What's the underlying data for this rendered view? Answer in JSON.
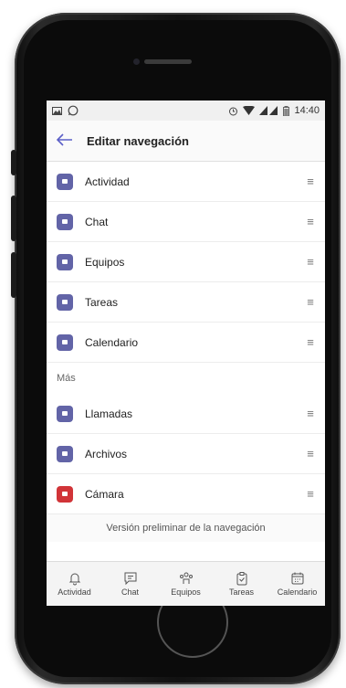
{
  "statusbar": {
    "left_icons": [
      "image-icon",
      "whatsapp-icon"
    ],
    "right_icons": [
      "alarm-icon",
      "wifi-icon",
      "signal-icon",
      "battery-icon"
    ],
    "time": "14:40"
  },
  "appbar": {
    "title": "Editar navegación",
    "back_icon": "arrow-back-icon"
  },
  "nav_items": [
    {
      "label": "Actividad",
      "icon": "activity-icon",
      "color": "#6264a7"
    },
    {
      "label": "Chat",
      "icon": "chat-icon",
      "color": "#6264a7"
    },
    {
      "label": "Equipos",
      "icon": "teams-icon",
      "color": "#6264a7"
    },
    {
      "label": "Tareas",
      "icon": "tasks-icon",
      "color": "#6264a7"
    },
    {
      "label": "Calendario",
      "icon": "calendar-icon",
      "color": "#6264a7"
    }
  ],
  "more_section": {
    "label": "Más"
  },
  "more_items": [
    {
      "label": "Llamadas",
      "icon": "calls-icon",
      "color": "#6264a7"
    },
    {
      "label": "Archivos",
      "icon": "files-icon",
      "color": "#6264a7"
    },
    {
      "label": "Cámara",
      "icon": "camera-icon",
      "color": "#d13438"
    }
  ],
  "preview": {
    "label": "Versión preliminar de la navegación"
  },
  "bottom_tabs": [
    {
      "label": "Actividad",
      "icon": "bell-icon"
    },
    {
      "label": "Chat",
      "icon": "chat-icon"
    },
    {
      "label": "Equipos",
      "icon": "teams-icon"
    },
    {
      "label": "Tareas",
      "icon": "tasks-icon"
    },
    {
      "label": "Calendario",
      "icon": "calendar-icon"
    }
  ],
  "colors": {
    "accent": "#6264a7",
    "camera": "#d13438"
  }
}
